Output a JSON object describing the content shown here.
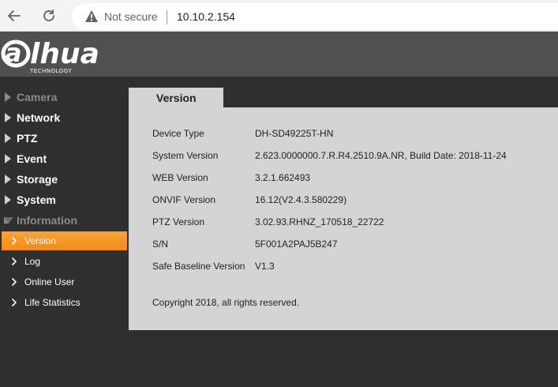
{
  "browser": {
    "security_label": "Not secure",
    "url": "10.10.2.154"
  },
  "logo": {
    "name": "alhua",
    "tagline": "TECHNOLOGY"
  },
  "sidebar": {
    "items": [
      {
        "label": "Camera"
      },
      {
        "label": "Network"
      },
      {
        "label": "PTZ"
      },
      {
        "label": "Event"
      },
      {
        "label": "Storage"
      },
      {
        "label": "System"
      },
      {
        "label": "Information"
      }
    ],
    "sub_items": [
      {
        "label": "Version",
        "active": true
      },
      {
        "label": "Log"
      },
      {
        "label": "Online User"
      },
      {
        "label": "Life Statistics"
      }
    ]
  },
  "main": {
    "tab_label": "Version",
    "rows": [
      {
        "key": "Device Type",
        "value": "DH-SD49225T-HN"
      },
      {
        "key": "System Version",
        "value": "2.623.0000000.7.R.R4.2510.9A.NR, Build Date: 2018-11-24"
      },
      {
        "key": "WEB Version",
        "value": "3.2.1.662493"
      },
      {
        "key": "ONVIF Version",
        "value": "16.12(V2.4.3.580229)"
      },
      {
        "key": "PTZ Version",
        "value": "3.02.93.RHNZ_170518_22722"
      },
      {
        "key": "S/N",
        "value": "5F001A2PAJ5B247"
      },
      {
        "key": "Safe Baseline Version",
        "value": "V1.3"
      }
    ],
    "copyright": "Copyright 2018, all rights reserved."
  },
  "colors": {
    "accent": "#f39020",
    "header": "#505050",
    "sidebar": "#2f2f2f",
    "panel": "#d4d4d4"
  }
}
